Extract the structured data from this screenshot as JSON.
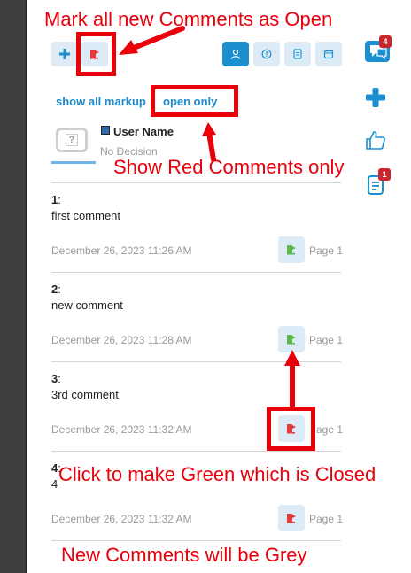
{
  "annotations": {
    "top": "Mark all new Comments as Open",
    "show_red": "Show Red Comments only",
    "click_green": "Click to make Green which is Closed",
    "new_grey": "New Comments will be Grey"
  },
  "filters": {
    "show_all": "show all markup",
    "open_only": "open only"
  },
  "user": {
    "name": "User Name",
    "decision": "No Decision"
  },
  "comments": [
    {
      "num": "1",
      "text": "first comment",
      "date": "December 26, 2023 11:26 AM",
      "page": "Page 1",
      "status": "closed"
    },
    {
      "num": "2",
      "text": "new comment",
      "date": "December 26, 2023 11:28 AM",
      "page": "Page 1",
      "status": "closed"
    },
    {
      "num": "3",
      "text": "3rd comment",
      "date": "December 26, 2023 11:32 AM",
      "page": "age 1",
      "status": "open"
    },
    {
      "num": "4",
      "text": "4",
      "date": "December 26, 2023 11:32 AM",
      "page": "Page 1",
      "status": "open"
    }
  ],
  "side": {
    "comments_badge": "4",
    "notes_badge": "1"
  },
  "colors": {
    "accent": "#1b8fd0",
    "open": "#e23b3b",
    "closed": "#5db94a",
    "annotation": "#e8000b"
  }
}
